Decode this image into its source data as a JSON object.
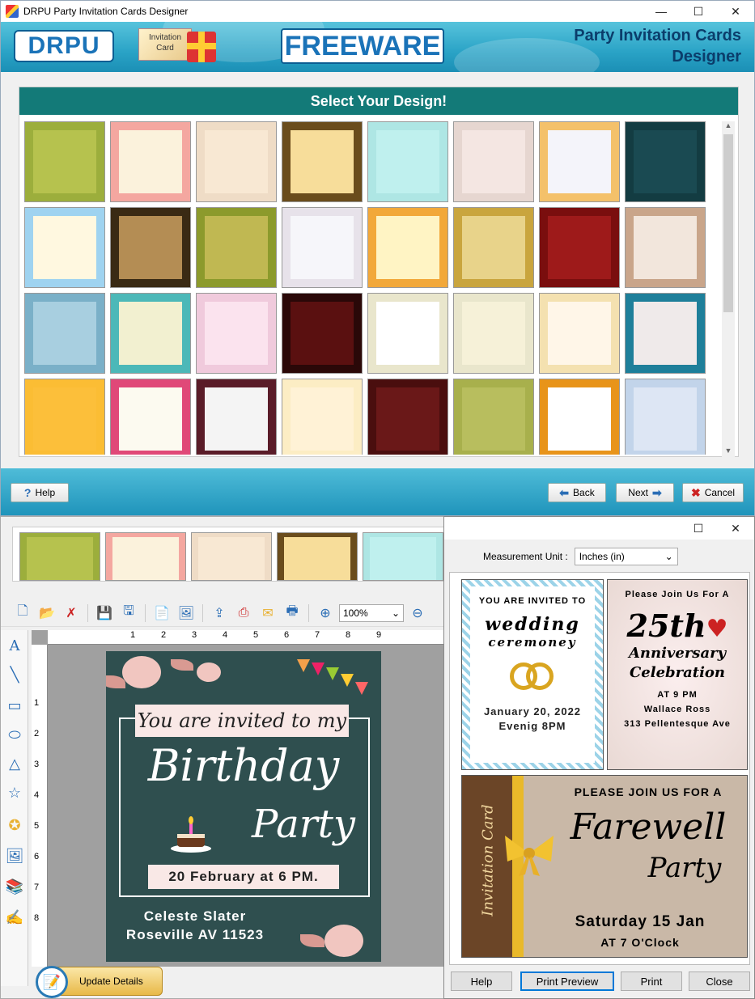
{
  "main_window": {
    "title": "DRPU Party Invitation Cards Designer",
    "controls": {
      "minimize": "—",
      "maximize": "☐",
      "close": "✕"
    },
    "banner": {
      "logo": "DRPU",
      "card_logo_text": "Invitation Card",
      "freeware": "FREEWARE",
      "title_line1": "Party Invitation Cards",
      "title_line2": "Designer"
    },
    "design_header": "Select Your Design!",
    "designs": [
      {
        "bg": "#9cae3c",
        "inner": "#b6c24e"
      },
      {
        "bg": "#f4a7a0",
        "inner": "#fbf2dc"
      },
      {
        "bg": "#efdcc6",
        "inner": "#f8e8d3"
      },
      {
        "bg": "#6a4c1c",
        "inner": "#f7dd9a"
      },
      {
        "bg": "#aee6e4",
        "inner": "#bff0ee"
      },
      {
        "bg": "#e6d6d0",
        "inner": "#f4e6e2"
      },
      {
        "bg": "#f4c16a",
        "inner": "#f4f4fa"
      },
      {
        "bg": "#133c42",
        "inner": "#1a4a52"
      },
      {
        "bg": "#9fd3f0",
        "inner": "#fff8e0"
      },
      {
        "bg": "#3a2a14",
        "inner": "#b48d54"
      },
      {
        "bg": "#8c9a2c",
        "inner": "#c0b852"
      },
      {
        "bg": "#e7e2ea",
        "inner": "#f6f6fa"
      },
      {
        "bg": "#f2a83a",
        "inner": "#fff4c4"
      },
      {
        "bg": "#c9a53e",
        "inner": "#e8d38a"
      },
      {
        "bg": "#7a0e0e",
        "inner": "#9e1a1a"
      },
      {
        "bg": "#c9a58a",
        "inner": "#f2e6dc"
      },
      {
        "bg": "#7ab0c8",
        "inner": "#a8cfe0"
      },
      {
        "bg": "#4cb8b8",
        "inner": "#f2f0d0"
      },
      {
        "bg": "#f0cadc",
        "inner": "#fbe3ee"
      },
      {
        "bg": "#2a0808",
        "inner": "#5a1010"
      },
      {
        "bg": "#e9e6cc",
        "inner": "#ffffff"
      },
      {
        "bg": "#e9e6cc",
        "inner": "#f6f1d8"
      },
      {
        "bg": "#f4e1b0",
        "inner": "#fff6e8"
      },
      {
        "bg": "#1e7f9a",
        "inner": "#efeaea"
      },
      {
        "bg": "#fbbd34",
        "inner": "#fcbf3a"
      },
      {
        "bg": "#e04878",
        "inner": "#fcfaf0"
      },
      {
        "bg": "#5a1c28",
        "inner": "#f4f4f4"
      },
      {
        "bg": "#fcedc4",
        "inner": "#fff2d6"
      },
      {
        "bg": "#4a0e0e",
        "inner": "#6a1818"
      },
      {
        "bg": "#a8b04c",
        "inner": "#b8be5e"
      },
      {
        "bg": "#e8941a",
        "inner": "#ffffff"
      },
      {
        "bg": "#c2d4ea",
        "inner": "#dde6f4"
      }
    ],
    "footer": {
      "help": "Help",
      "back": "Back",
      "next": "Next",
      "cancel": "Cancel"
    }
  },
  "editor_window": {
    "toolbar_zoom": "100%",
    "ruler_h": [
      "1",
      "2",
      "3",
      "4",
      "5",
      "6",
      "7",
      "8",
      "9"
    ],
    "ruler_v": [
      "1",
      "2",
      "3",
      "4",
      "5",
      "6",
      "7",
      "8"
    ],
    "card": {
      "invited": "You are invited to my",
      "title1": "Birthday",
      "title2": "Party",
      "date": "20 February at 6 PM.",
      "name": "Celeste Slater",
      "address": "Roseville AV 11523"
    },
    "update_button": "Update Details"
  },
  "preview_window": {
    "controls": {
      "maximize": "☐",
      "close": "✕"
    },
    "measurement_label": "Measurement Unit :",
    "measurement_value": "Inches (in)",
    "cards": {
      "wedding": {
        "line1": "YOU ARE INVITED TO",
        "line2": "wedding",
        "line3": "ceremoney",
        "line4": "January 20, 2022",
        "line5": "Evenig 8PM"
      },
      "anniversary": {
        "line1": "Please Join Us For A",
        "line2": "25th",
        "line3": "Anniversary",
        "line4": "Celebration",
        "line5": "AT 9 PM",
        "line6": "Wallace Ross",
        "line7": "313 Pellentesque Ave"
      },
      "farewell": {
        "vertical": "Invitation Card",
        "line1": "PLEASE JOIN US FOR A",
        "line2": "Farewell",
        "line3": "Party",
        "line4": "Saturday 15 Jan",
        "line5": "AT 7 O'Clock"
      }
    },
    "buttons": {
      "help": "Help",
      "print_preview": "Print Preview",
      "print": "Print",
      "close": "Close"
    }
  }
}
